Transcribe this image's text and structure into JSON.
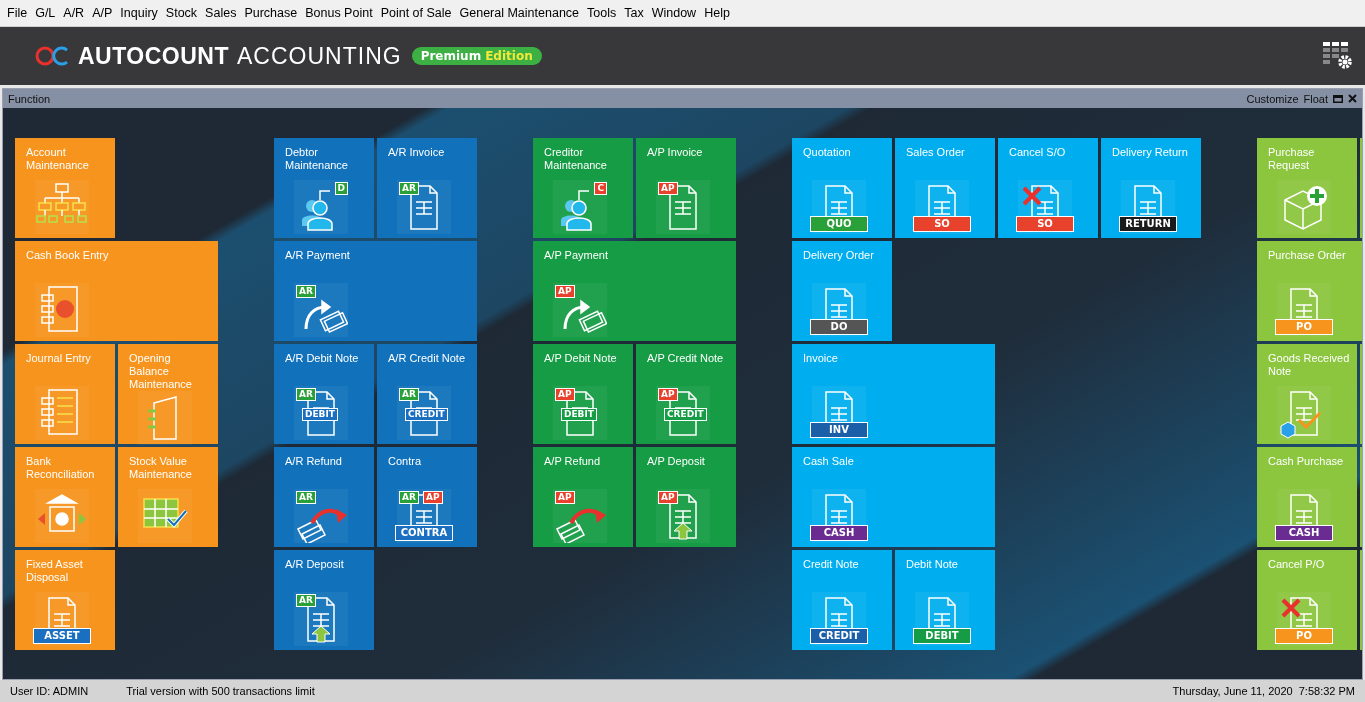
{
  "menu": [
    "File",
    "G/L",
    "A/R",
    "A/P",
    "Inquiry",
    "Stock",
    "Sales",
    "Purchase",
    "Bonus Point",
    "Point of Sale",
    "General Maintenance",
    "Tools",
    "Tax",
    "Window",
    "Help"
  ],
  "brand": {
    "name": "AUTOCOUNT",
    "product": "ACCOUNTING",
    "edition": "Premium",
    "edition_suffix": "Edition"
  },
  "panel": {
    "title": "Function",
    "actions": [
      "Customize",
      "Float"
    ]
  },
  "groups": [
    {
      "color": "#f7941d",
      "rows": [
        [
          {
            "label": "Account Maintenance",
            "wide": false,
            "kind": "org-chart"
          }
        ],
        [
          {
            "label": "Cash Book Entry",
            "wide": true,
            "kind": "ledger"
          }
        ],
        [
          {
            "label": "Journal Entry",
            "wide": false,
            "kind": "journal"
          },
          {
            "label": "Opening Balance Maintenance",
            "wide": false,
            "kind": "binder"
          }
        ],
        [
          {
            "label": "Bank Reconciliation",
            "wide": false,
            "kind": "bank"
          },
          {
            "label": "Stock Value Maintenance",
            "wide": false,
            "kind": "sheet-check"
          }
        ],
        [
          {
            "label": "Fixed Asset Disposal",
            "wide": false,
            "kind": "document",
            "badges": [
              {
                "text": "ASSET",
                "color": "#1a6fc0",
                "kind": "stamp"
              }
            ]
          }
        ]
      ]
    },
    {
      "color": "#1172bb",
      "rows": [
        [
          {
            "label": "Debtor Maintenance",
            "wide": false,
            "kind": "person",
            "badges": [
              {
                "text": "D",
                "color": "#2aa038",
                "kind": "corner"
              }
            ]
          },
          {
            "label": "A/R Invoice",
            "wide": false,
            "kind": "document",
            "badges": [
              {
                "text": "AR",
                "color": "#2aa038",
                "kind": "top"
              }
            ]
          }
        ],
        [
          {
            "label": "A/R Payment",
            "wide": true,
            "kind": "payment",
            "badges": [
              {
                "text": "AR",
                "color": "#2aa038",
                "kind": "top"
              }
            ]
          }
        ],
        [
          {
            "label": "A/R Debit Note",
            "wide": false,
            "kind": "document",
            "badges": [
              {
                "text": "AR",
                "color": "#2aa038",
                "kind": "top"
              },
              {
                "text": "DEBIT",
                "color": "#1a6fc0",
                "kind": "mid"
              }
            ]
          },
          {
            "label": "A/R Credit Note",
            "wide": false,
            "kind": "document",
            "badges": [
              {
                "text": "AR",
                "color": "#2aa038",
                "kind": "top"
              },
              {
                "text": "CREDIT",
                "color": "#1a6fc0",
                "kind": "mid"
              }
            ]
          }
        ],
        [
          {
            "label": "A/R Refund",
            "wide": false,
            "kind": "refund",
            "badges": [
              {
                "text": "AR",
                "color": "#2aa038",
                "kind": "top"
              }
            ]
          },
          {
            "label": "Contra",
            "wide": false,
            "kind": "document",
            "badges": [
              {
                "text": "AR",
                "color": "#2aa038",
                "kind": "top"
              },
              {
                "text": "AP",
                "color": "#e8412c",
                "kind": "second"
              },
              {
                "text": "CONTRA",
                "color": "#1a6fc0",
                "kind": "stamp"
              }
            ]
          }
        ],
        [
          {
            "label": "A/R Deposit",
            "wide": false,
            "kind": "deposit",
            "badges": [
              {
                "text": "AR",
                "color": "#2aa038",
                "kind": "top"
              }
            ]
          }
        ]
      ]
    },
    {
      "color": "#169c45",
      "rows": [
        [
          {
            "label": "Creditor Maintenance",
            "wide": false,
            "kind": "person",
            "badges": [
              {
                "text": "C",
                "color": "#e8412c",
                "kind": "corner"
              }
            ]
          },
          {
            "label": "A/P Invoice",
            "wide": false,
            "kind": "document",
            "badges": [
              {
                "text": "AP",
                "color": "#e8412c",
                "kind": "top"
              }
            ]
          }
        ],
        [
          {
            "label": "A/P Payment",
            "wide": true,
            "kind": "payment",
            "badges": [
              {
                "text": "AP",
                "color": "#e8412c",
                "kind": "top"
              }
            ]
          }
        ],
        [
          {
            "label": "A/P Debit Note",
            "wide": false,
            "kind": "document",
            "badges": [
              {
                "text": "AP",
                "color": "#e8412c",
                "kind": "top"
              },
              {
                "text": "DEBIT",
                "color": "#169c45",
                "kind": "mid"
              }
            ]
          },
          {
            "label": "A/P Credit Note",
            "wide": false,
            "kind": "document",
            "badges": [
              {
                "text": "AP",
                "color": "#e8412c",
                "kind": "top"
              },
              {
                "text": "CREDIT",
                "color": "#169c45",
                "kind": "mid"
              }
            ]
          }
        ],
        [
          {
            "label": "A/P Refund",
            "wide": false,
            "kind": "refund",
            "badges": [
              {
                "text": "AP",
                "color": "#e8412c",
                "kind": "top"
              }
            ]
          },
          {
            "label": "A/P Deposit",
            "wide": false,
            "kind": "deposit",
            "badges": [
              {
                "text": "AP",
                "color": "#e8412c",
                "kind": "top"
              }
            ]
          }
        ]
      ]
    },
    {
      "color": "#00aeef",
      "rows": [
        [
          {
            "label": "Quotation",
            "wide": false,
            "kind": "document",
            "badges": [
              {
                "text": "QUO",
                "color": "#2aa038",
                "kind": "stamp"
              }
            ]
          },
          {
            "label": "Sales Order",
            "wide": false,
            "kind": "document",
            "badges": [
              {
                "text": "SO",
                "color": "#e8412c",
                "kind": "stamp"
              }
            ]
          },
          {
            "label": "Cancel S/O",
            "wide": false,
            "kind": "cancel",
            "badges": [
              {
                "text": "SO",
                "color": "#e8412c",
                "kind": "stamp"
              }
            ]
          },
          {
            "label": "Delivery Return",
            "wide": false,
            "kind": "document",
            "badges": [
              {
                "text": "RETURN",
                "color": "#1a1a1a",
                "kind": "stamp"
              }
            ]
          }
        ],
        [
          {
            "label": "Delivery Order",
            "wide": false,
            "kind": "document",
            "badges": [
              {
                "text": "DO",
                "color": "#555555",
                "kind": "stamp"
              }
            ]
          }
        ],
        [
          {
            "label": "Invoice",
            "wide": true,
            "kind": "document",
            "badges": [
              {
                "text": "INV",
                "color": "#1a5fa8",
                "kind": "stamp"
              }
            ]
          }
        ],
        [
          {
            "label": "Cash Sale",
            "wide": true,
            "kind": "document",
            "badges": [
              {
                "text": "CASH",
                "color": "#6a2c91",
                "kind": "stamp"
              }
            ]
          }
        ],
        [
          {
            "label": "Credit Note",
            "wide": false,
            "kind": "document",
            "badges": [
              {
                "text": "CREDIT",
                "color": "#1a5fa8",
                "kind": "stamp"
              }
            ]
          },
          {
            "label": "Debit Note",
            "wide": false,
            "kind": "document",
            "badges": [
              {
                "text": "DEBIT",
                "color": "#169c45",
                "kind": "stamp"
              }
            ]
          }
        ]
      ]
    },
    {
      "color": "#8cc63f",
      "rows": [
        [
          {
            "label": "Purchase Request",
            "wide": false,
            "kind": "box-plus"
          },
          {
            "wide": false
          }
        ],
        [
          {
            "label": "Purchase Order",
            "wide": true,
            "kind": "document",
            "badges": [
              {
                "text": "PO",
                "color": "#f7941d",
                "kind": "stamp"
              }
            ]
          }
        ],
        [
          {
            "label": "Goods Received Note",
            "wide": false,
            "kind": "goods"
          },
          {
            "wide": false
          }
        ],
        [
          {
            "label": "Cash Purchase",
            "wide": false,
            "kind": "document",
            "badges": [
              {
                "text": "CASH",
                "color": "#6a2c91",
                "kind": "stamp"
              }
            ]
          },
          {
            "wide": false
          }
        ],
        [
          {
            "label": "Cancel P/O",
            "wide": false,
            "kind": "cancel",
            "badges": [
              {
                "text": "PO",
                "color": "#f7941d",
                "kind": "stamp"
              }
            ]
          },
          {
            "wide": false
          }
        ]
      ]
    }
  ],
  "status_bar": {
    "user": "User ID: ADMIN",
    "notice": "Trial version with 500 transactions limit",
    "datetime": "Thursday, June 11, 2020  7:58:32 PM"
  }
}
